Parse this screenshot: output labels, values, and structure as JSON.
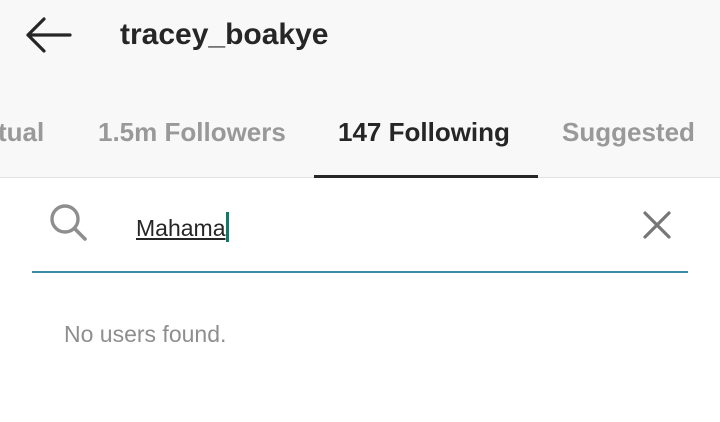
{
  "header": {
    "back_icon": "arrow-left-icon",
    "username": "tracey_boakye"
  },
  "tabs": [
    {
      "label": "Mutual",
      "visible_text": "tual",
      "active": false
    },
    {
      "label": "1.5m Followers",
      "active": false
    },
    {
      "label": "147 Following",
      "active": true
    },
    {
      "label": "Suggested",
      "active": false
    }
  ],
  "search": {
    "icon": "search-icon",
    "value": "Mahama",
    "clear_icon": "close-icon"
  },
  "results": {
    "empty_message": "No users found."
  },
  "colors": {
    "header_bg": "#f8f8f8",
    "text_primary": "#262626",
    "text_secondary": "#999999",
    "accent_cursor": "#0f7a6b",
    "search_underline": "#3a8ca0"
  }
}
